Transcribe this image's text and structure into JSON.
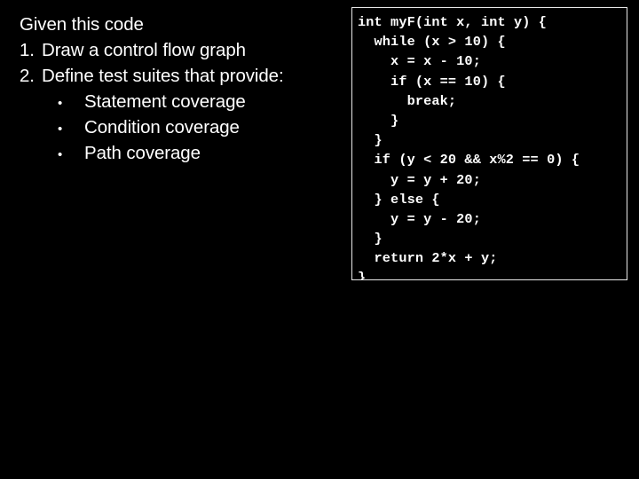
{
  "slide": {
    "background_color": "#000000",
    "text_color": "#ffffff",
    "border_color": "#e8e8e8"
  },
  "outline": {
    "heading": "Given this code",
    "items": [
      {
        "marker": "1.",
        "text": "Draw a control flow graph"
      },
      {
        "marker": "2.",
        "text": "Define test suites that provide:"
      }
    ],
    "bullets": [
      {
        "marker": "•",
        "text": "Statement coverage"
      },
      {
        "marker": "•",
        "text": "Condition coverage"
      },
      {
        "marker": "•",
        "text": "Path coverage"
      }
    ]
  },
  "code_block": {
    "language": "c",
    "lines": [
      "int myF(int x, int y) {",
      "  while (x > 10) {",
      "    x = x - 10;",
      "    if (x == 10) {",
      "      break;",
      "    }",
      "  }",
      "  if (y < 20 && x%2 == 0) {",
      "    y = y + 20;",
      "  } else {",
      "    y = y - 20;",
      "  }",
      "  return 2*x + y;",
      "}"
    ]
  }
}
